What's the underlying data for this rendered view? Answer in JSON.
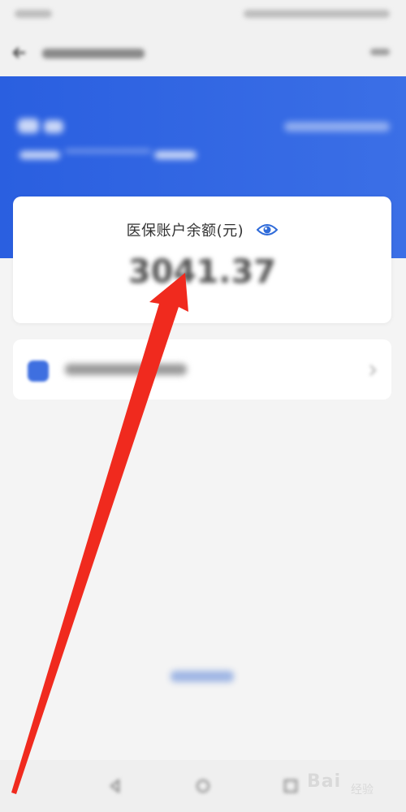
{
  "balance_card": {
    "label": "医保账户余额(元)",
    "amount": "3041.37"
  },
  "watermark": {
    "text": "Bai",
    "sub": "经验"
  },
  "colors": {
    "header_blue": "#2a5fe0",
    "arrow_red": "#f02a1e",
    "eye_blue": "#2f6bd9"
  },
  "icons": {
    "visibility": "eye-icon",
    "back": "back-arrow-icon",
    "next": "chevron-right-icon"
  }
}
